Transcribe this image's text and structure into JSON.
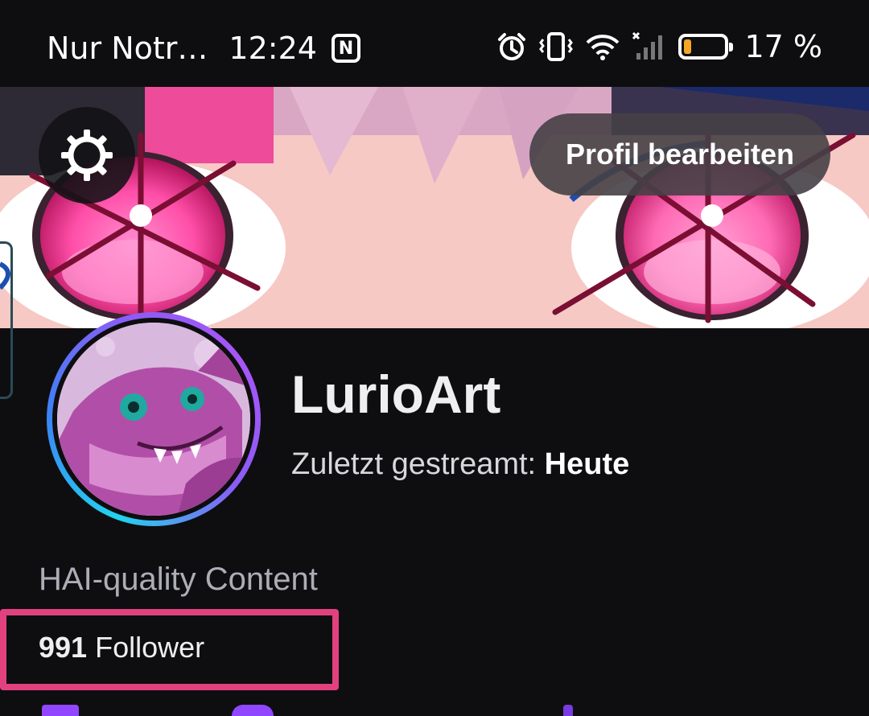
{
  "status_bar": {
    "carrier": "Nur Notr…",
    "time": "12:24",
    "battery_percent_label": "17 %",
    "battery_level": 0.17,
    "icons": [
      "nfc-icon",
      "alarm-icon",
      "vibrate-icon",
      "wifi-icon",
      "signal-icon",
      "battery-icon"
    ]
  },
  "header": {
    "edit_profile_label": "Profil bearbeiten",
    "settings_icon": "gear-icon"
  },
  "profile": {
    "name": "LurioArt",
    "last_streamed_prefix": "Zuletzt gestreamt: ",
    "last_streamed_value": "Heute",
    "bio": "HAI-quality Content",
    "followers_count": "991",
    "followers_label": "Follower"
  },
  "colors": {
    "background": "#0e0e10",
    "highlight_box": "#e2417f",
    "twitch_purple": "#9147ff"
  }
}
